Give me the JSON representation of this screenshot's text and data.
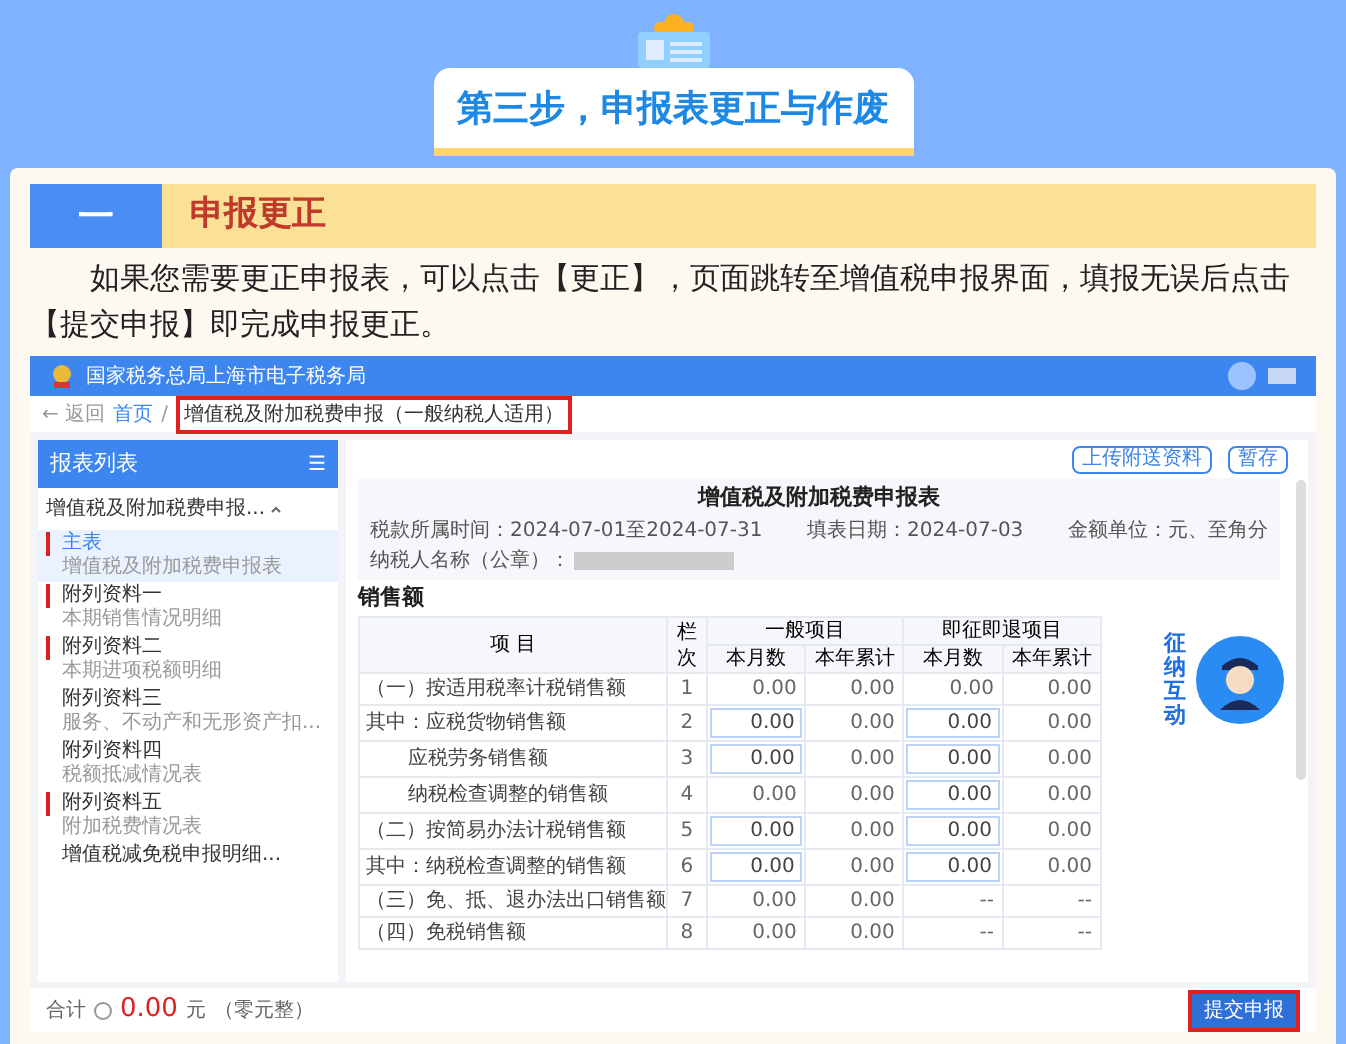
{
  "header": {
    "title": "第三步，申报表更正与作废"
  },
  "section": {
    "number": "一",
    "title": "申报更正"
  },
  "paragraph": "如果您需要更正申报表，可以点击【更正】，页面跳转至增值税申报界面，填报无误后点击【提交申报】即完成申报更正。",
  "screenshot": {
    "site_title": "国家税务总局上海市电子税务局",
    "breadcrumb": {
      "back": "← 返回",
      "home": "首页",
      "separator": "/",
      "current": "增值税及附加税费申报（一般纳税人适用）",
      "highlighted": true
    },
    "sidebar": {
      "title": "报表列表",
      "menu_icon": "☰",
      "group": "增值税及附加税费申报...",
      "expanded": true,
      "items": [
        {
          "title": "主表",
          "subtitle": "增值税及附加税费申报表",
          "required": true,
          "selected": true
        },
        {
          "title": "附列资料一",
          "subtitle": "本期销售情况明细",
          "required": true,
          "selected": false
        },
        {
          "title": "附列资料二",
          "subtitle": "本期进项税额明细",
          "required": true,
          "selected": false
        },
        {
          "title": "附列资料三",
          "subtitle": "服务、不动产和无形资产扣...",
          "required": false,
          "selected": false
        },
        {
          "title": "附列资料四",
          "subtitle": "税额抵减情况表",
          "required": false,
          "selected": false
        },
        {
          "title": "附列资料五",
          "subtitle": "附加税费情况表",
          "required": true,
          "selected": false
        },
        {
          "title": "增值税减免税申报明细...",
          "required": false,
          "selected": false
        }
      ]
    },
    "buttons": [
      "上传附送资料",
      "暂存"
    ],
    "form": {
      "title": "增值税及附加税费申报表",
      "period": "税款所属时间：2024-07-01至2024-07-31",
      "date": "填表日期：2024-07-03",
      "unit": "金额单位：元、至角分",
      "taxpayer_label": "纳税人名称（公章）："
    },
    "section_title": "销售额",
    "table": {
      "columns": [
        "项 目",
        "栏次"
      ],
      "groups": [
        "一般项目",
        "即征即退项目"
      ],
      "subcolumns": [
        "本月数",
        "本年累计",
        "本月数",
        "本年累计"
      ],
      "rows": [
        {
          "item": "（一）按适用税率计税销售额",
          "indent": false,
          "line": "1",
          "cells": [
            {
              "kind": "text",
              "value": "0.00"
            },
            {
              "kind": "text",
              "value": "0.00"
            },
            {
              "kind": "text",
              "value": "0.00"
            },
            {
              "kind": "text",
              "value": "0.00"
            }
          ]
        },
        {
          "item": "其中：应税货物销售额",
          "indent": false,
          "line": "2",
          "cells": [
            {
              "kind": "input",
              "value": "0.00"
            },
            {
              "kind": "text",
              "value": "0.00"
            },
            {
              "kind": "input",
              "value": "0.00"
            },
            {
              "kind": "text",
              "value": "0.00"
            }
          ]
        },
        {
          "item": "应税劳务销售额",
          "indent": true,
          "line": "3",
          "cells": [
            {
              "kind": "input",
              "value": "0.00"
            },
            {
              "kind": "text",
              "value": "0.00"
            },
            {
              "kind": "input",
              "value": "0.00"
            },
            {
              "kind": "text",
              "value": "0.00"
            }
          ]
        },
        {
          "item": "纳税检查调整的销售额",
          "indent": true,
          "line": "4",
          "cells": [
            {
              "kind": "text",
              "value": "0.00"
            },
            {
              "kind": "text",
              "value": "0.00"
            },
            {
              "kind": "input",
              "value": "0.00"
            },
            {
              "kind": "text",
              "value": "0.00"
            }
          ]
        },
        {
          "item": "（二）按简易办法计税销售额",
          "indent": false,
          "line": "5",
          "cells": [
            {
              "kind": "input",
              "value": "0.00"
            },
            {
              "kind": "text",
              "value": "0.00"
            },
            {
              "kind": "input",
              "value": "0.00"
            },
            {
              "kind": "text",
              "value": "0.00"
            }
          ]
        },
        {
          "item": "其中：纳税检查调整的销售额",
          "indent": false,
          "line": "6",
          "cells": [
            {
              "kind": "input",
              "value": "0.00"
            },
            {
              "kind": "text",
              "value": "0.00"
            },
            {
              "kind": "input",
              "value": "0.00"
            },
            {
              "kind": "text",
              "value": "0.00"
            }
          ]
        },
        {
          "item": "（三）免、抵、退办法出口销售额",
          "indent": false,
          "line": "7",
          "cells": [
            {
              "kind": "text",
              "value": "0.00"
            },
            {
              "kind": "text",
              "value": "0.00"
            },
            {
              "kind": "text",
              "value": "--"
            },
            {
              "kind": "text",
              "value": "--"
            }
          ]
        },
        {
          "item": "（四）免税销售额",
          "indent": false,
          "line": "8",
          "cells": [
            {
              "kind": "text",
              "value": "0.00"
            },
            {
              "kind": "text",
              "value": "0.00"
            },
            {
              "kind": "text",
              "value": "--"
            },
            {
              "kind": "text",
              "value": "--"
            }
          ]
        }
      ]
    },
    "footer": {
      "total_label": "合计",
      "amount": "0.00",
      "currency": "元",
      "amount_words": "（零元整）",
      "submit": "提交申报",
      "submit_highlighted": true
    },
    "mascot": {
      "text": "征纳互动"
    }
  }
}
